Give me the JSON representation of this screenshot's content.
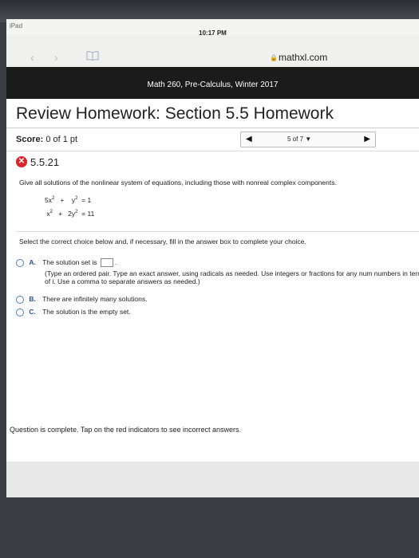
{
  "device": {
    "name": "iPad",
    "wifi_icon": "wifi-icon"
  },
  "status": {
    "time": "10:17 PM"
  },
  "browser": {
    "domain": "mathxl.com",
    "lock_icon": "lock-icon"
  },
  "course": {
    "name": "Math 260, Pre-Calculus, Winter 2017"
  },
  "page": {
    "title": "Review Homework: Section 5.5 Homework"
  },
  "score": {
    "label": "Score:",
    "value": "0 of 1 pt"
  },
  "pager": {
    "position": "5 of 7 ▼"
  },
  "question": {
    "number": "5.5.21",
    "status_mark": "✕",
    "prompt": "Give all solutions of the nonlinear system of equations, including those with nonreal complex components.",
    "eq1": {
      "a": "5x",
      "exp_a": "2",
      "op": "+",
      "b": "y",
      "exp_b": "2",
      "rhs": "= 1"
    },
    "eq2": {
      "a": "x",
      "exp_a": "2",
      "op": "+",
      "b": "2y",
      "exp_b": "2",
      "rhs": "= 11"
    },
    "select_text": "Select the correct choice below and, if necessary, fill in the answer box to complete your choice.",
    "choices": [
      {
        "letter": "A.",
        "text": "The solution set is",
        "after": "."
      },
      {
        "letter": "B.",
        "text": "There are infinitely many solutions."
      },
      {
        "letter": "C.",
        "text": "The solution is the empty set."
      }
    ],
    "hint": "(Type an ordered pair. Type an exact answer, using radicals as needed. Use integers or fractions for any num numbers in terms of i. Use a comma to separate answers as needed.)"
  },
  "footer": {
    "message": "Question is complete. Tap on the red indicators to see incorrect answers."
  }
}
